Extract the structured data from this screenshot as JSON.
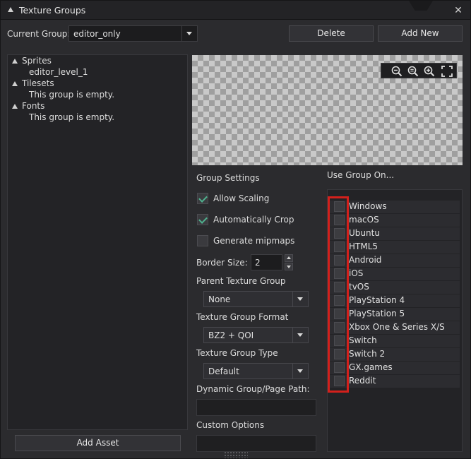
{
  "window": {
    "title": "Texture Groups"
  },
  "header": {
    "current_group_label": "Current Group:",
    "current_group_value": "editor_only",
    "delete_label": "Delete",
    "add_new_label": "Add New"
  },
  "tree": [
    {
      "label": "Sprites",
      "children": [
        "editor_level_1"
      ]
    },
    {
      "label": "Tilesets",
      "children": [
        "This group is empty."
      ]
    },
    {
      "label": "Fonts",
      "children": [
        "This group is empty."
      ]
    }
  ],
  "add_asset_label": "Add Asset",
  "preview": {
    "icons": [
      "zoom-out-icon",
      "zoom-reset-icon",
      "zoom-in-icon",
      "fullscreen-icon"
    ]
  },
  "settings": {
    "heading": "Group Settings",
    "allow_scaling": {
      "label": "Allow Scaling",
      "checked": true
    },
    "auto_crop": {
      "label": "Automatically Crop",
      "checked": true
    },
    "mipmaps": {
      "label": "Generate mipmaps",
      "checked": false
    },
    "border_size_label": "Border Size:",
    "border_size_value": "2",
    "parent_label": "Parent Texture Group",
    "parent_value": "None",
    "format_label": "Texture Group Format",
    "format_value": "BZ2 + QOI",
    "type_label": "Texture Group Type",
    "type_value": "Default",
    "dynamic_path_label": "Dynamic Group/Page Path:",
    "dynamic_path_value": "",
    "custom_options_label": "Custom Options",
    "custom_options_value": ""
  },
  "use_group_on": {
    "heading": "Use Group On...",
    "platforms": [
      "Windows",
      "macOS",
      "Ubuntu",
      "HTML5",
      "Android",
      "iOS",
      "tvOS",
      "PlayStation 4",
      "PlayStation 5",
      "Xbox One & Series X/S",
      "Switch",
      "Switch 2",
      "GX.games",
      "Reddit"
    ],
    "checked": [
      false,
      false,
      false,
      false,
      false,
      false,
      false,
      false,
      false,
      false,
      false,
      false,
      false,
      false
    ]
  },
  "colors": {
    "highlight": "#d3201c",
    "check": "#4fb28f",
    "background": "#2b2b2e"
  }
}
